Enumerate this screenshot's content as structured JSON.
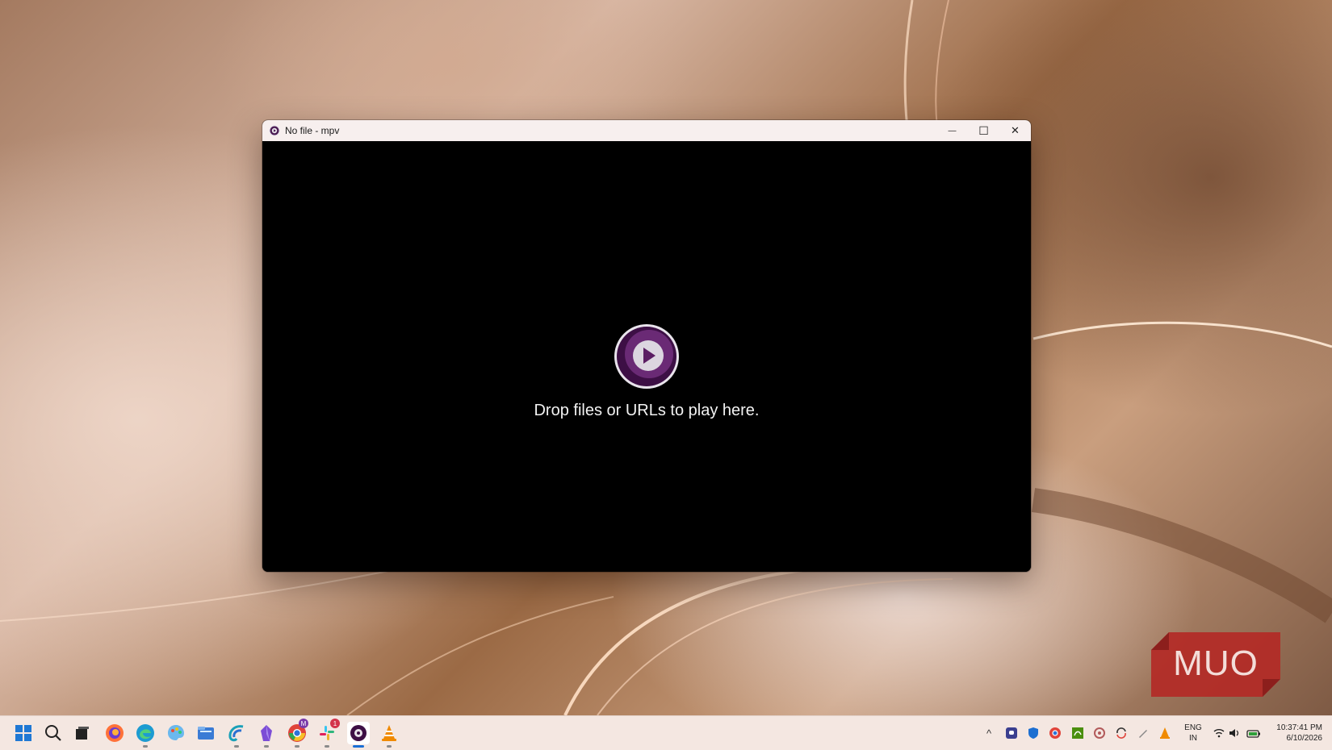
{
  "window": {
    "title": "No file - mpv",
    "drop_text": "Drop files or URLs to play here.",
    "controls": {
      "minimize": "—",
      "maximize": "☐",
      "close": "✕"
    }
  },
  "watermark": {
    "text": "MUO"
  },
  "taskbar": {
    "pinned": [
      {
        "name": "start-icon",
        "color": "#1a73e8"
      },
      {
        "name": "search-icon",
        "color": "#333333"
      },
      {
        "name": "task-view-icon",
        "color": "#222222"
      },
      {
        "name": "firefox-icon",
        "color": "#ff7139"
      },
      {
        "name": "edge-icon",
        "color": "#1d9bd1"
      },
      {
        "name": "paint-icon",
        "color": "#2f8fd8"
      },
      {
        "name": "file-explorer-icon",
        "color": "#3a7bd5"
      },
      {
        "name": "cortana-icon",
        "color": "#1aa0b8"
      },
      {
        "name": "obsidian-icon",
        "color": "#7c4dd6"
      },
      {
        "name": "chrome-icon",
        "color": "#e0433a",
        "badge": "M"
      },
      {
        "name": "slack-icon",
        "color": "#4a154b",
        "badge": "1"
      },
      {
        "name": "mpv-icon",
        "color": "#5b1d63"
      },
      {
        "name": "vlc-icon",
        "color": "#f08a00"
      }
    ],
    "tray": {
      "chevron": "^",
      "lang_top": "ENG",
      "lang_bottom": "IN",
      "time": "10:37:41 PM",
      "date": "6/10/2026"
    }
  }
}
